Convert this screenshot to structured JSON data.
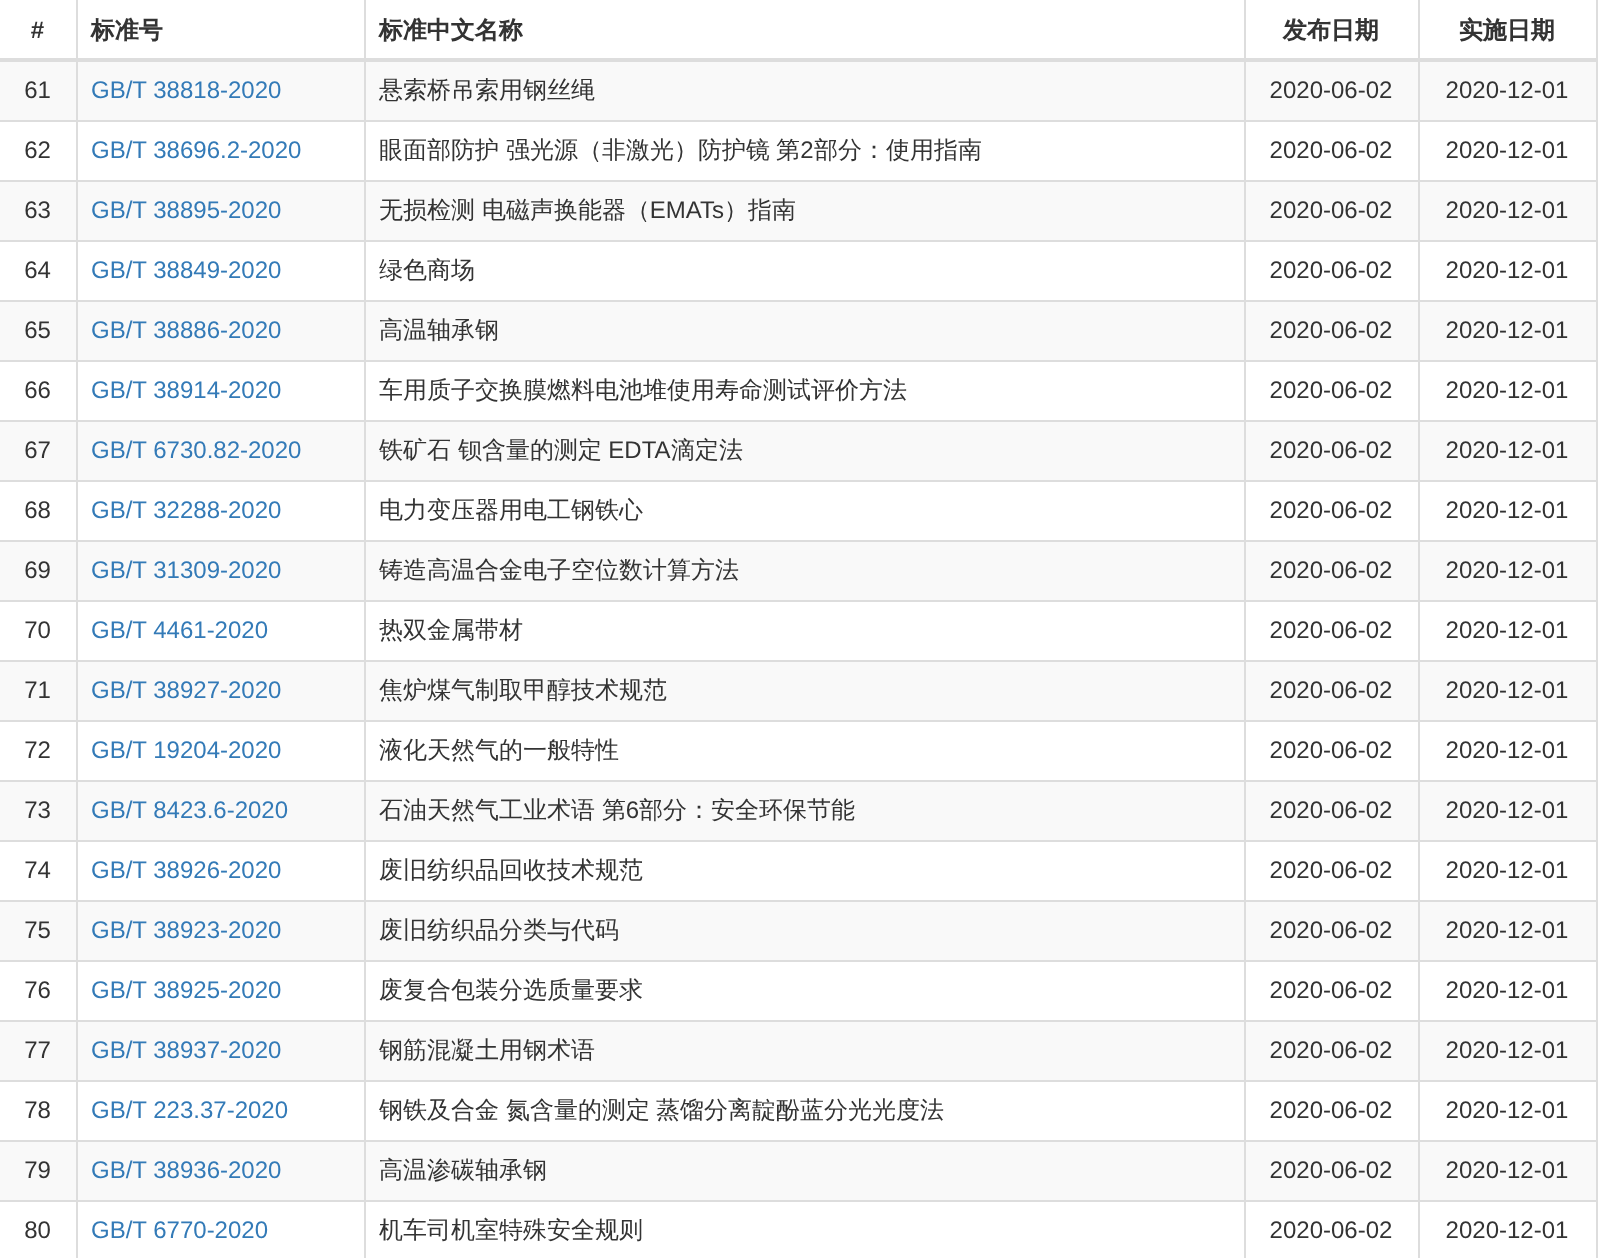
{
  "table": {
    "columns": [
      "#",
      "标准号",
      "标准中文名称",
      "发布日期",
      "实施日期"
    ],
    "rows": [
      {
        "no": "61",
        "code": "GB/T 38818-2020",
        "name": "悬索桥吊索用钢丝绳",
        "published": "2020-06-02",
        "effective": "2020-12-01"
      },
      {
        "no": "62",
        "code": "GB/T 38696.2-2020",
        "name": "眼面部防护 强光源（非激光）防护镜 第2部分：使用指南",
        "published": "2020-06-02",
        "effective": "2020-12-01"
      },
      {
        "no": "63",
        "code": "GB/T 38895-2020",
        "name": "无损检测 电磁声换能器（EMATs）指南",
        "published": "2020-06-02",
        "effective": "2020-12-01"
      },
      {
        "no": "64",
        "code": "GB/T 38849-2020",
        "name": "绿色商场",
        "published": "2020-06-02",
        "effective": "2020-12-01"
      },
      {
        "no": "65",
        "code": "GB/T 38886-2020",
        "name": "高温轴承钢",
        "published": "2020-06-02",
        "effective": "2020-12-01"
      },
      {
        "no": "66",
        "code": "GB/T 38914-2020",
        "name": "车用质子交换膜燃料电池堆使用寿命测试评价方法",
        "published": "2020-06-02",
        "effective": "2020-12-01"
      },
      {
        "no": "67",
        "code": "GB/T 6730.82-2020",
        "name": "铁矿石 钡含量的测定 EDTA滴定法",
        "published": "2020-06-02",
        "effective": "2020-12-01"
      },
      {
        "no": "68",
        "code": "GB/T 32288-2020",
        "name": "电力变压器用电工钢铁心",
        "published": "2020-06-02",
        "effective": "2020-12-01"
      },
      {
        "no": "69",
        "code": "GB/T 31309-2020",
        "name": "铸造高温合金电子空位数计算方法",
        "published": "2020-06-02",
        "effective": "2020-12-01"
      },
      {
        "no": "70",
        "code": "GB/T 4461-2020",
        "name": "热双金属带材",
        "published": "2020-06-02",
        "effective": "2020-12-01"
      },
      {
        "no": "71",
        "code": "GB/T 38927-2020",
        "name": "焦炉煤气制取甲醇技术规范",
        "published": "2020-06-02",
        "effective": "2020-12-01"
      },
      {
        "no": "72",
        "code": "GB/T 19204-2020",
        "name": "液化天然气的一般特性",
        "published": "2020-06-02",
        "effective": "2020-12-01"
      },
      {
        "no": "73",
        "code": "GB/T 8423.6-2020",
        "name": "石油天然气工业术语 第6部分：安全环保节能",
        "published": "2020-06-02",
        "effective": "2020-12-01"
      },
      {
        "no": "74",
        "code": "GB/T 38926-2020",
        "name": "废旧纺织品回收技术规范",
        "published": "2020-06-02",
        "effective": "2020-12-01"
      },
      {
        "no": "75",
        "code": "GB/T 38923-2020",
        "name": "废旧纺织品分类与代码",
        "published": "2020-06-02",
        "effective": "2020-12-01"
      },
      {
        "no": "76",
        "code": "GB/T 38925-2020",
        "name": "废复合包装分选质量要求",
        "published": "2020-06-02",
        "effective": "2020-12-01"
      },
      {
        "no": "77",
        "code": "GB/T 38937-2020",
        "name": "钢筋混凝土用钢术语",
        "published": "2020-06-02",
        "effective": "2020-12-01"
      },
      {
        "no": "78",
        "code": "GB/T 223.37-2020",
        "name": "钢铁及合金 氮含量的测定 蒸馏分离靛酚蓝分光光度法",
        "published": "2020-06-02",
        "effective": "2020-12-01"
      },
      {
        "no": "79",
        "code": "GB/T 38936-2020",
        "name": "高温渗碳轴承钢",
        "published": "2020-06-02",
        "effective": "2020-12-01"
      },
      {
        "no": "80",
        "code": "GB/T 6770-2020",
        "name": "机车司机室特殊安全规则",
        "published": "2020-06-02",
        "effective": "2020-12-01"
      }
    ]
  }
}
